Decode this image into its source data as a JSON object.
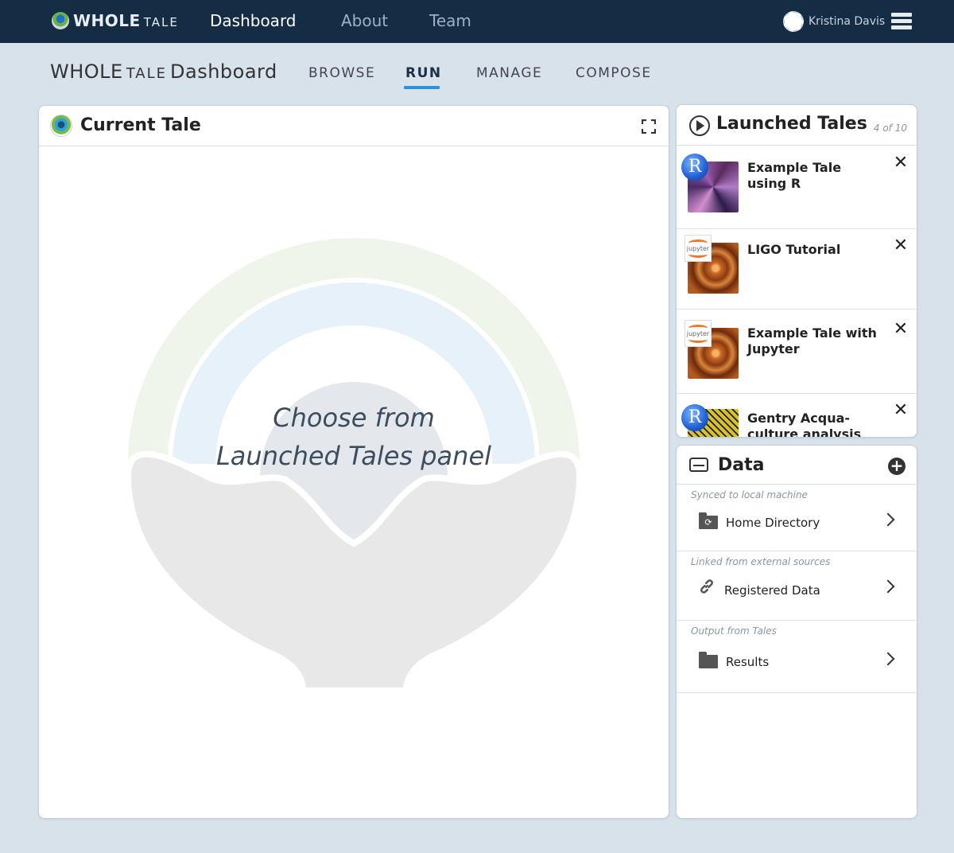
{
  "topnav": {
    "logo_main": "WHOLE",
    "logo_sub": "TALE",
    "links": [
      "Dashboard",
      "About",
      "Team"
    ],
    "active": "Dashboard",
    "user_name": "Kristina Davis"
  },
  "header": {
    "title_main": "WHOLE",
    "title_tale": "TALE",
    "title_rest": "Dashboard",
    "tabs": [
      "BROWSE",
      "RUN",
      "MANAGE",
      "COMPOSE"
    ],
    "active_tab": "RUN"
  },
  "current_tale": {
    "title": "Current Tale",
    "placeholder_line1": "Choose from",
    "placeholder_line2": "Launched Tales panel"
  },
  "launched": {
    "title": "Launched Tales",
    "count": "4 of 10",
    "tales": [
      {
        "name": "Example Tale using R",
        "environment": "R"
      },
      {
        "name": "LIGO Tutorial",
        "environment": "jupyter"
      },
      {
        "name": "Example Tale with Jupyter",
        "environment": "jupyter"
      },
      {
        "name": "Gentry Acqua- culture analysis",
        "environment": "R"
      }
    ]
  },
  "data": {
    "title": "Data",
    "groups": [
      {
        "caption": "Synced to local machine",
        "label": "Home Directory",
        "icon": "sync-folder-icon"
      },
      {
        "caption": "Linked from external sources",
        "label": "Registered Data",
        "icon": "link-icon"
      },
      {
        "caption": "Output from Tales",
        "label": "Results",
        "icon": "folder-icon"
      }
    ]
  },
  "colors": {
    "topbar": "#152c45",
    "page_bg": "#d8e2ea",
    "accent": "#2f8fd8"
  }
}
